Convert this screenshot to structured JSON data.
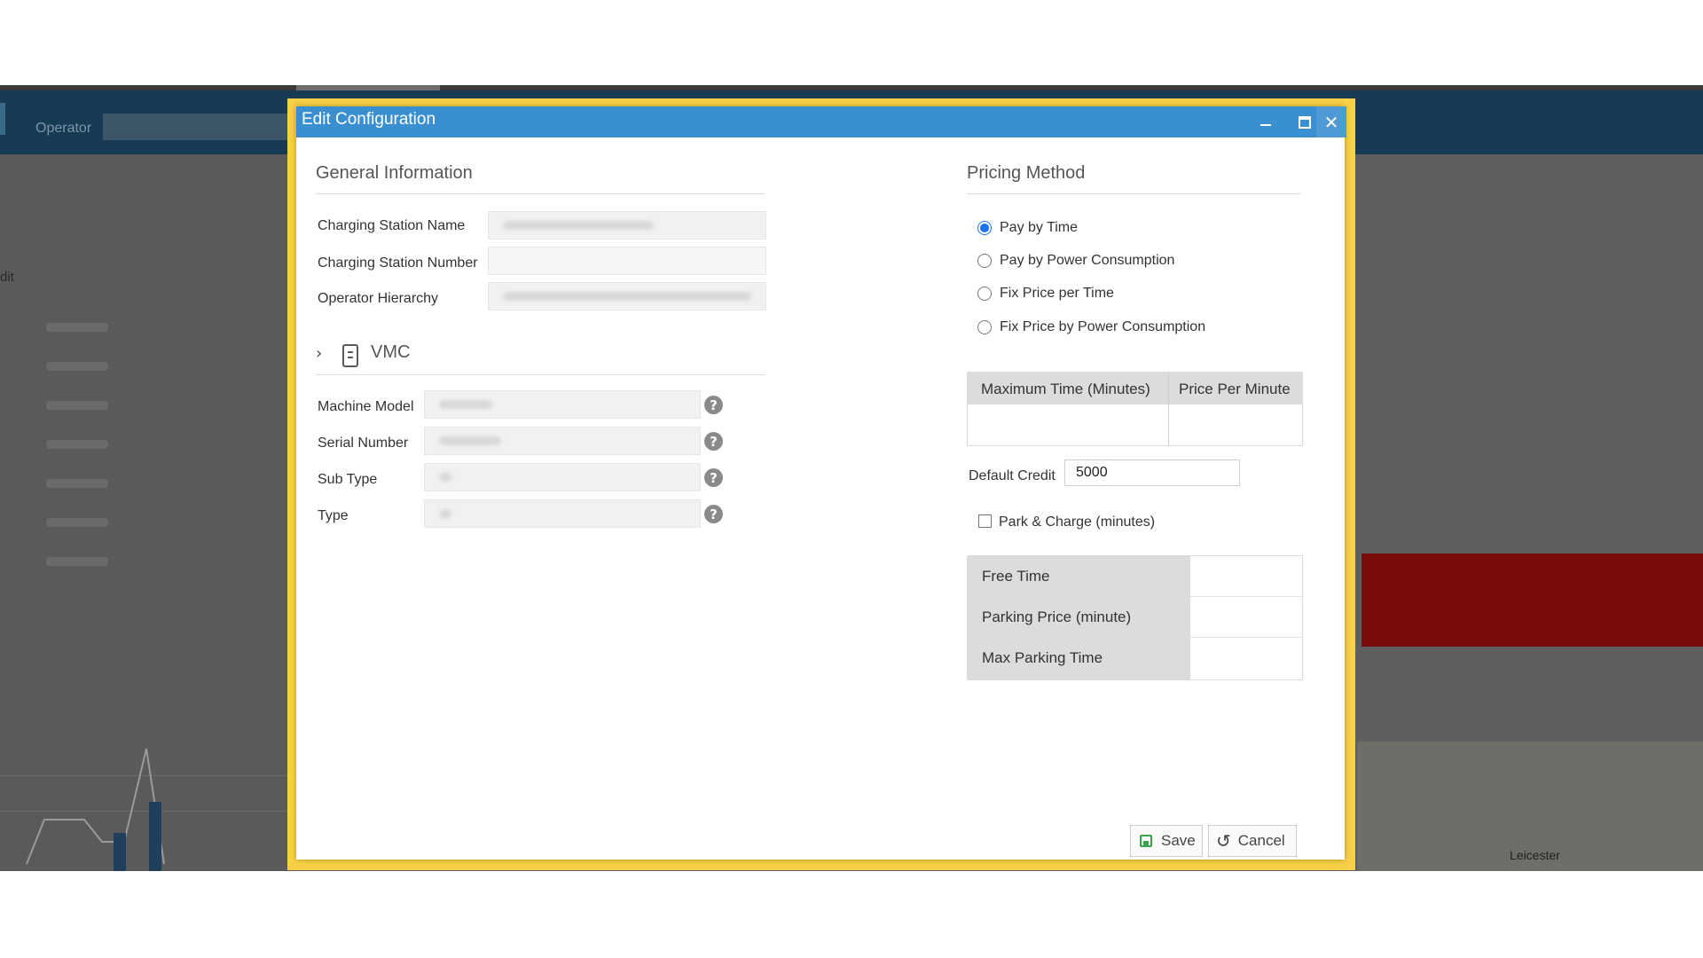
{
  "background": {
    "operator_label": "Operator",
    "edge_text": "dit",
    "map_label": "Leicester"
  },
  "modal": {
    "title": "Edit Configuration",
    "controls": {
      "minimize": "minimize-icon",
      "maximize": "maximize-icon",
      "close": "close-icon"
    },
    "general": {
      "title": "General Information",
      "fields": [
        {
          "label": "Charging Station Name",
          "value": ""
        },
        {
          "label": "Charging Station Number",
          "value": ""
        },
        {
          "label": "Operator Hierarchy",
          "value": ""
        }
      ]
    },
    "vmc": {
      "title": "VMC",
      "fields": [
        {
          "label": "Machine Model",
          "value": ""
        },
        {
          "label": "Serial Number",
          "value": ""
        },
        {
          "label": "Sub Type",
          "value": ""
        },
        {
          "label": "Type",
          "value": ""
        }
      ]
    },
    "pricing": {
      "title": "Pricing Method",
      "options": [
        {
          "label": "Pay by Time",
          "checked": true
        },
        {
          "label": "Pay by Power Consumption",
          "checked": false
        },
        {
          "label": "Fix Price per Time",
          "checked": false
        },
        {
          "label": "Fix Price by Power Consumption",
          "checked": false
        }
      ],
      "table_headers": [
        "Maximum Time (Minutes)",
        "Price Per Minute"
      ],
      "default_credit_label": "Default Credit",
      "default_credit_value": "5000",
      "park_charge_label": "Park & Charge (minutes)",
      "park_rows": [
        "Free Time",
        "Parking Price (minute)",
        "Max Parking Time"
      ]
    },
    "buttons": {
      "save": "Save",
      "cancel": "Cancel"
    }
  },
  "colors": {
    "titlebar": "#3a8fd1",
    "highlight_frame": "#f7d046",
    "radio_checked": "#1a73e8",
    "save_icon": "#3aa34a"
  }
}
